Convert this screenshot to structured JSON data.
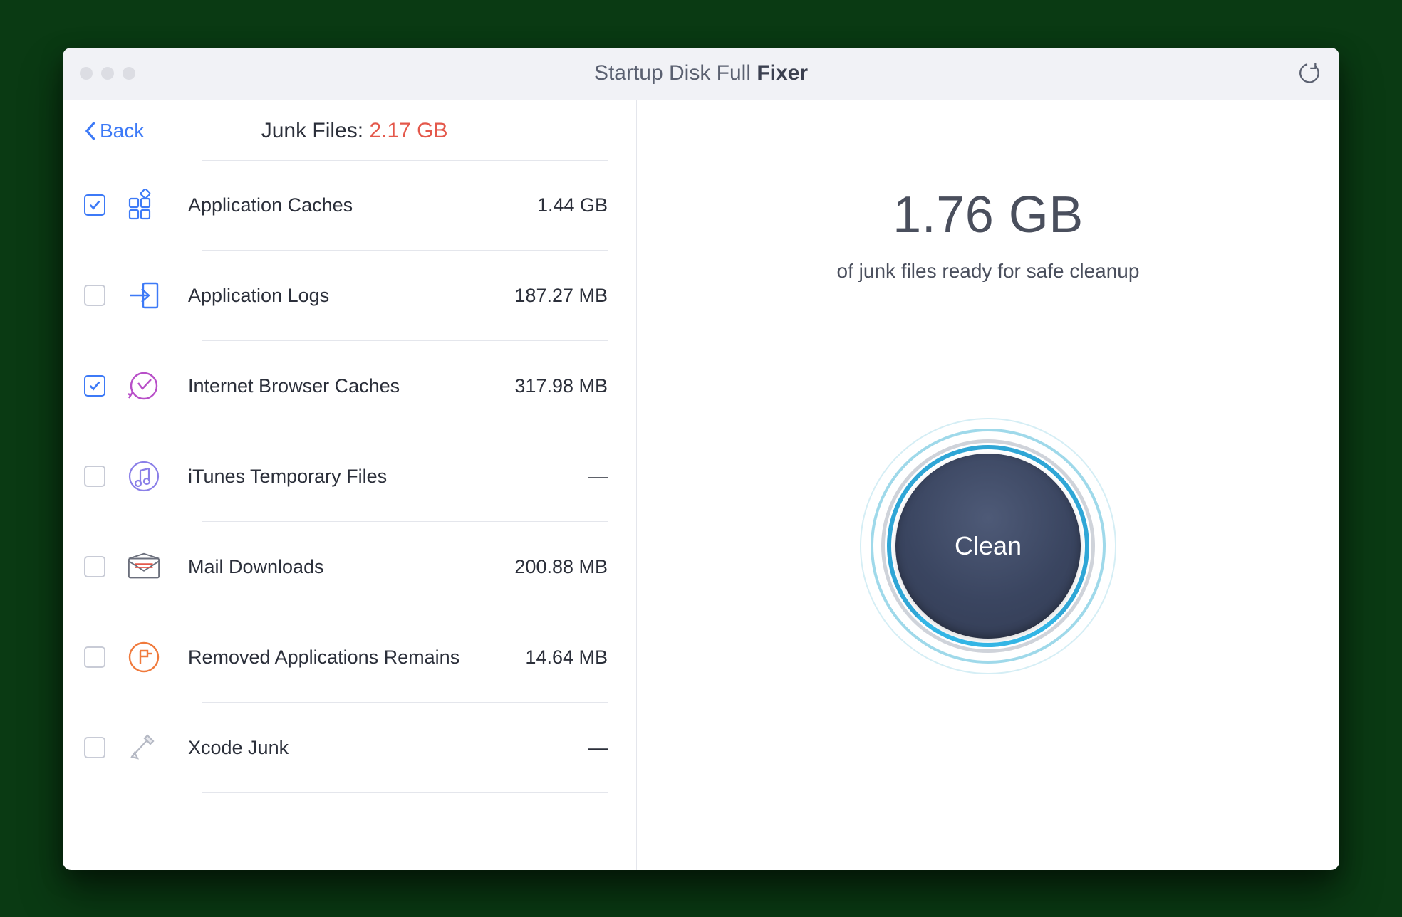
{
  "title": {
    "prefix": "Startup Disk Full ",
    "bold": "Fixer"
  },
  "back_label": "Back",
  "junk_header": {
    "label": "Junk Files: ",
    "size": "2.17 GB"
  },
  "items": [
    {
      "checked": true,
      "label": "Application Caches",
      "value": "1.44 GB",
      "icon": "app-caches"
    },
    {
      "checked": false,
      "label": "Application Logs",
      "value": "187.27 MB",
      "icon": "app-logs"
    },
    {
      "checked": true,
      "label": "Internet Browser Caches",
      "value": "317.98 MB",
      "icon": "browser-caches"
    },
    {
      "checked": false,
      "label": "iTunes Temporary Files",
      "value": "—",
      "icon": "itunes"
    },
    {
      "checked": false,
      "label": "Mail Downloads",
      "value": "200.88 MB",
      "icon": "mail"
    },
    {
      "checked": false,
      "label": "Removed Applications Remains",
      "value": "14.64 MB",
      "icon": "removed-apps"
    },
    {
      "checked": false,
      "label": "Xcode Junk",
      "value": "—",
      "icon": "xcode"
    }
  ],
  "summary": {
    "size": "1.76 GB",
    "subtitle": "of junk files ready for safe cleanup"
  },
  "clean_label": "Clean"
}
